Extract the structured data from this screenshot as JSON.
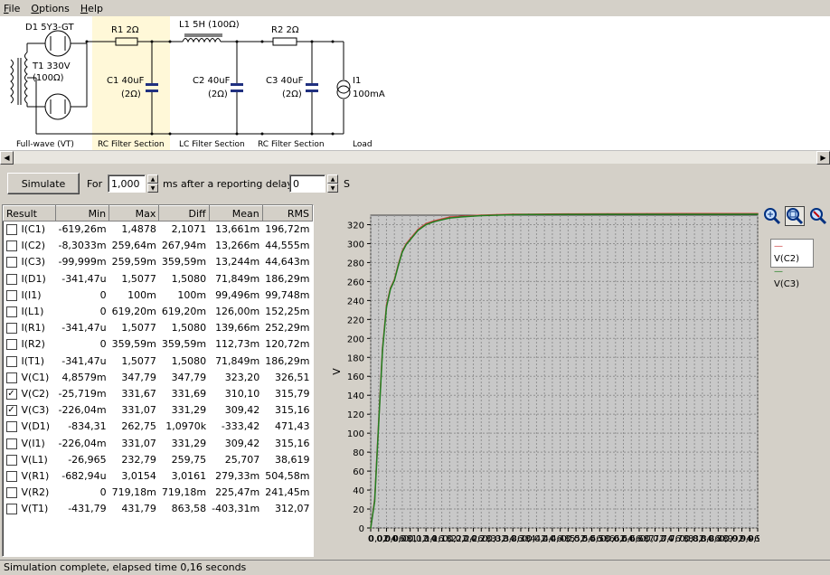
{
  "menu": [
    {
      "u": "F",
      "rest": "ile"
    },
    {
      "u": "O",
      "rest": "ptions"
    },
    {
      "u": "H",
      "rest": "elp"
    }
  ],
  "schematic": {
    "d1": "D1 5Y3-GT",
    "t1a": "T1 330V",
    "t1b": "(100Ω)",
    "r1": "R1 2Ω",
    "l1": "L1 5H (100Ω)",
    "r2": "R2 2Ω",
    "c1a": "C1 40uF",
    "c1b": "(2Ω)",
    "c2a": "C2 40uF",
    "c2b": "(2Ω)",
    "c3a": "C3 40uF",
    "c3b": "(2Ω)",
    "i1a": "I1",
    "i1b": "100mA",
    "sec_fullwave": "Full-wave (VT)",
    "sec_rc1": "RC Filter Section",
    "sec_lc": "LC Filter Section",
    "sec_rc2": "RC Filter Section",
    "sec_load": "Load"
  },
  "toolbar": {
    "simulate": "Simulate",
    "for": "For",
    "duration": "1,000",
    "ms": "ms",
    "after": "after a reporting delay of",
    "delay": "0",
    "s": "S"
  },
  "results": {
    "headers": [
      "Result",
      "Min",
      "Max",
      "Diff",
      "Mean",
      "RMS"
    ],
    "rows": [
      {
        "name": "I(C1)",
        "checked": false,
        "min": "-619,26m",
        "max": "1,4878",
        "diff": "2,1071",
        "mean": "13,661m",
        "rms": "196,72m"
      },
      {
        "name": "I(C2)",
        "checked": false,
        "min": "-8,3033m",
        "max": "259,64m",
        "diff": "267,94m",
        "mean": "13,266m",
        "rms": "44,555m"
      },
      {
        "name": "I(C3)",
        "checked": false,
        "min": "-99,999m",
        "max": "259,59m",
        "diff": "359,59m",
        "mean": "13,244m",
        "rms": "44,643m"
      },
      {
        "name": "I(D1)",
        "checked": false,
        "min": "-341,47u",
        "max": "1,5077",
        "diff": "1,5080",
        "mean": "71,849m",
        "rms": "186,29m"
      },
      {
        "name": "I(I1)",
        "checked": false,
        "min": "0",
        "max": "100m",
        "diff": "100m",
        "mean": "99,496m",
        "rms": "99,748m"
      },
      {
        "name": "I(L1)",
        "checked": false,
        "min": "0",
        "max": "619,20m",
        "diff": "619,20m",
        "mean": "126,00m",
        "rms": "152,25m"
      },
      {
        "name": "I(R1)",
        "checked": false,
        "min": "-341,47u",
        "max": "1,5077",
        "diff": "1,5080",
        "mean": "139,66m",
        "rms": "252,29m"
      },
      {
        "name": "I(R2)",
        "checked": false,
        "min": "0",
        "max": "359,59m",
        "diff": "359,59m",
        "mean": "112,73m",
        "rms": "120,72m"
      },
      {
        "name": "I(T1)",
        "checked": false,
        "min": "-341,47u",
        "max": "1,5077",
        "diff": "1,5080",
        "mean": "71,849m",
        "rms": "186,29m"
      },
      {
        "name": "V(C1)",
        "checked": false,
        "min": "4,8579m",
        "max": "347,79",
        "diff": "347,79",
        "mean": "323,20",
        "rms": "326,51"
      },
      {
        "name": "V(C2)",
        "checked": true,
        "min": "-25,719m",
        "max": "331,67",
        "diff": "331,69",
        "mean": "310,10",
        "rms": "315,79"
      },
      {
        "name": "V(C3)",
        "checked": true,
        "min": "-226,04m",
        "max": "331,07",
        "diff": "331,29",
        "mean": "309,42",
        "rms": "315,16"
      },
      {
        "name": "V(D1)",
        "checked": false,
        "min": "-834,31",
        "max": "262,75",
        "diff": "1,0970k",
        "mean": "-333,42",
        "rms": "471,43"
      },
      {
        "name": "V(I1)",
        "checked": false,
        "min": "-226,04m",
        "max": "331,07",
        "diff": "331,29",
        "mean": "309,42",
        "rms": "315,16"
      },
      {
        "name": "V(L1)",
        "checked": false,
        "min": "-26,965",
        "max": "232,79",
        "diff": "259,75",
        "mean": "25,707",
        "rms": "38,619"
      },
      {
        "name": "V(R1)",
        "checked": false,
        "min": "-682,94u",
        "max": "3,0154",
        "diff": "3,0161",
        "mean": "279,33m",
        "rms": "504,58m"
      },
      {
        "name": "V(R2)",
        "checked": false,
        "min": "0",
        "max": "719,18m",
        "diff": "719,18m",
        "mean": "225,47m",
        "rms": "241,45m"
      },
      {
        "name": "V(T1)",
        "checked": false,
        "min": "-431,79",
        "max": "431,79",
        "diff": "863,58",
        "mean": "-403,31m",
        "rms": "312,07"
      }
    ]
  },
  "chart_data": {
    "type": "line",
    "ylabel": "V",
    "ylim": [
      0,
      330
    ],
    "yticks": [
      0,
      20,
      40,
      60,
      80,
      100,
      120,
      140,
      160,
      180,
      200,
      220,
      240,
      260,
      280,
      300,
      320
    ],
    "xlim": [
      0,
      0.98
    ],
    "xticks": [
      "0",
      "0,02",
      "0,04",
      "0,06",
      "0,08",
      "0,1",
      "0,12",
      "0,14",
      "0,16",
      "0,18",
      "0,2",
      "0,22",
      "0,24",
      "0,26",
      "0,28",
      "0,3",
      "0,32",
      "0,34",
      "0,36",
      "0,38",
      "0,4",
      "0,42",
      "0,44",
      "0,46",
      "0,48",
      "0,5",
      "0,52",
      "0,54",
      "0,56",
      "0,58",
      "0,6",
      "0,62",
      "0,64",
      "0,66",
      "0,68",
      "0,7",
      "0,72",
      "0,74",
      "0,76",
      "0,78",
      "0,8",
      "0,82",
      "0,84",
      "0,86",
      "0,88",
      "0,9",
      "0,92",
      "0,94",
      "0,96",
      "0,98"
    ],
    "grid": true,
    "legend": "top-right",
    "series": [
      {
        "name": "V(C2)",
        "color": "#d04040",
        "x": [
          0,
          0.01,
          0.02,
          0.03,
          0.04,
          0.05,
          0.06,
          0.07,
          0.08,
          0.09,
          0.1,
          0.12,
          0.14,
          0.16,
          0.18,
          0.2,
          0.24,
          0.28,
          0.32,
          0.36,
          0.4,
          0.45,
          0.5,
          0.6,
          0.7,
          0.8,
          0.9,
          0.98
        ],
        "y": [
          0,
          30,
          110,
          190,
          235,
          253,
          262,
          278,
          292,
          300,
          305,
          315,
          321,
          324,
          326,
          328,
          329,
          330,
          330.5,
          331,
          331,
          331.2,
          331.3,
          331.4,
          331.5,
          331.6,
          331.6,
          331.7
        ]
      },
      {
        "name": "V(C3)",
        "color": "#208020",
        "x": [
          0,
          0.01,
          0.02,
          0.03,
          0.04,
          0.05,
          0.06,
          0.07,
          0.08,
          0.09,
          0.1,
          0.12,
          0.14,
          0.16,
          0.18,
          0.2,
          0.24,
          0.28,
          0.32,
          0.36,
          0.4,
          0.45,
          0.5,
          0.6,
          0.7,
          0.8,
          0.9,
          0.98
        ],
        "y": [
          0,
          28,
          108,
          188,
          233,
          252,
          261,
          277,
          291,
          299,
          304,
          314,
          320,
          323,
          325,
          327,
          328.5,
          329.5,
          330,
          330.5,
          330.7,
          330.8,
          330.9,
          331,
          331,
          331,
          331,
          331.07
        ]
      }
    ]
  },
  "status": {
    "text": "Simulation complete, elapsed time 0,16 seconds"
  }
}
